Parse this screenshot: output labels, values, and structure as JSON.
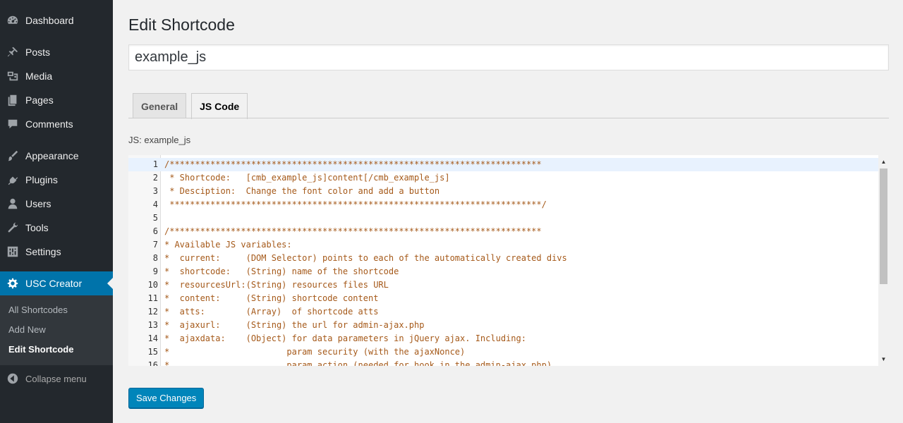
{
  "sidebar": {
    "items": [
      {
        "label": "Dashboard",
        "icon": "dashboard-icon"
      },
      {
        "label": "Posts",
        "icon": "pin-icon"
      },
      {
        "label": "Media",
        "icon": "media-icon"
      },
      {
        "label": "Pages",
        "icon": "pages-icon"
      },
      {
        "label": "Comments",
        "icon": "comment-icon"
      },
      {
        "label": "Appearance",
        "icon": "brush-icon"
      },
      {
        "label": "Plugins",
        "icon": "plug-icon"
      },
      {
        "label": "Users",
        "icon": "user-icon"
      },
      {
        "label": "Tools",
        "icon": "wrench-icon"
      },
      {
        "label": "Settings",
        "icon": "settings-icon"
      },
      {
        "label": "USC Creator",
        "icon": "gear-icon"
      }
    ],
    "submenu": [
      "All Shortcodes",
      "Add New",
      "Edit Shortcode"
    ],
    "collapse_label": "Collapse menu"
  },
  "page": {
    "title": "Edit Shortcode",
    "shortcode_name": "example_js",
    "tabs": [
      "General",
      "JS Code"
    ],
    "active_tab": "JS Code",
    "js_label": "JS: example_js",
    "save_label": "Save Changes"
  },
  "code": [
    "/*************************************************************************",
    " * Shortcode:   [cmb_example_js]content[/cmb_example_js]",
    " * Desciption:  Change the font color and add a button",
    " *************************************************************************/",
    "",
    "/*************************************************************************",
    "* Available JS variables:",
    "*  current:     (DOM Selector) points to each of the automatically created divs",
    "*  shortcode:   (String) name of the shortcode",
    "*  resourcesUrl:(String) resources files URL",
    "*  content:     (String) shortcode content",
    "*  atts:        (Array)  of shortcode atts",
    "*  ajaxurl:     (String) the url for admin-ajax.php",
    "*  ajaxdata:    (Object) for data parameters in jQuery ajax. Including:",
    "*                       param security (with the ajaxNonce)",
    "*                       param action (needed for hook in the admin-ajax.php)"
  ],
  "colors": {
    "sidebar_bg": "#23282d",
    "active_menu": "#0073aa",
    "button": "#0085ba",
    "code_text": "#a55919"
  }
}
